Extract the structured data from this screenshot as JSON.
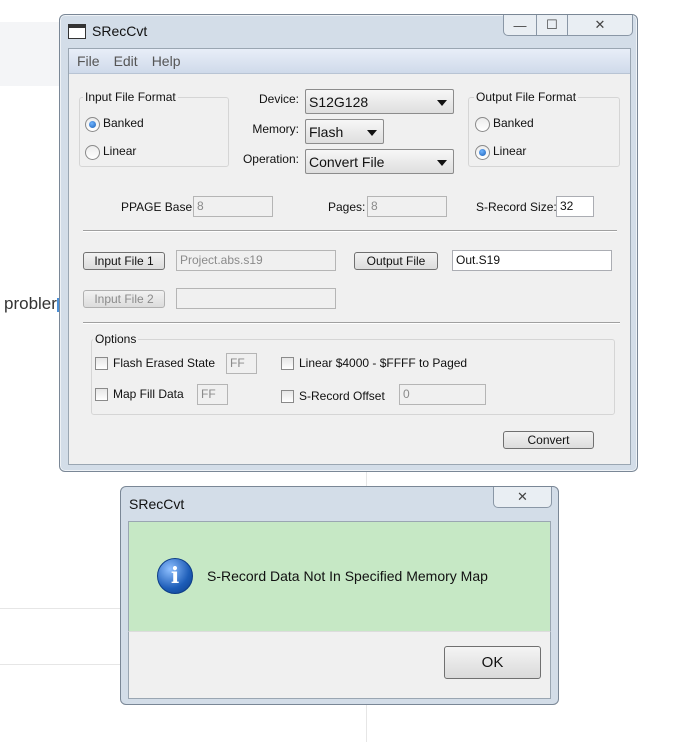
{
  "background": {
    "partial_text": "probler"
  },
  "main_window": {
    "title": "SRecCvt",
    "caption_buttons": {
      "minimize": "—",
      "maximize": "☐",
      "close": "✕"
    },
    "menu": [
      "File",
      "Edit",
      "Help"
    ],
    "input_file_format": {
      "label": "Input File Format",
      "options": [
        "Banked",
        "Linear"
      ],
      "selected": "Banked"
    },
    "device": {
      "label": "Device:",
      "value": "S12G128"
    },
    "memory": {
      "label": "Memory:",
      "value": "Flash"
    },
    "operation": {
      "label": "Operation:",
      "value": "Convert File"
    },
    "output_file_format": {
      "label": "Output File Format",
      "options": [
        "Banked",
        "Linear"
      ],
      "selected": "Linear"
    },
    "ppage_base": {
      "label": "PPAGE Base:",
      "value": "8"
    },
    "pages": {
      "label": "Pages:",
      "value": "8"
    },
    "srecord_size": {
      "label": "S-Record Size:",
      "value": "32"
    },
    "input_file_1": {
      "button": "Input File 1",
      "value": "Project.abs.s19"
    },
    "output_file": {
      "button": "Output File",
      "value": "Out.S19"
    },
    "input_file_2": {
      "button": "Input File 2",
      "value": ""
    },
    "options": {
      "label": "Options",
      "flash_erased_state": {
        "label": "Flash Erased State",
        "value": "FF"
      },
      "linear_to_paged": {
        "label": "Linear $4000 - $FFFF to Paged"
      },
      "map_fill_data": {
        "label": "Map Fill Data",
        "value": "FF"
      },
      "srecord_offset": {
        "label": "S-Record Offset",
        "value": "0"
      }
    },
    "convert_button": "Convert"
  },
  "dialog": {
    "title": "SRecCvt",
    "close": "✕",
    "icon": "info-icon",
    "icon_glyph": "i",
    "message": "S-Record Data Not In Specified Memory Map",
    "ok_button": "OK"
  }
}
